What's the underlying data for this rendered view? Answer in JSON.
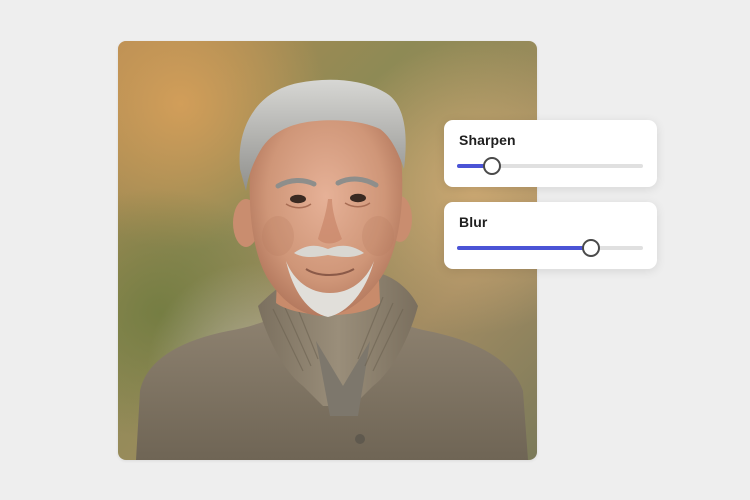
{
  "photo": {
    "subject": "portrait-photo"
  },
  "adjustments": {
    "sharpen": {
      "label": "Sharpen",
      "value": 0.19
    },
    "blur": {
      "label": "Blur",
      "value": 0.72
    }
  },
  "colors": {
    "background": "#eeeeee",
    "accent": "#4b54d6",
    "track": "#e0e0e0",
    "panel": "#ffffff"
  }
}
